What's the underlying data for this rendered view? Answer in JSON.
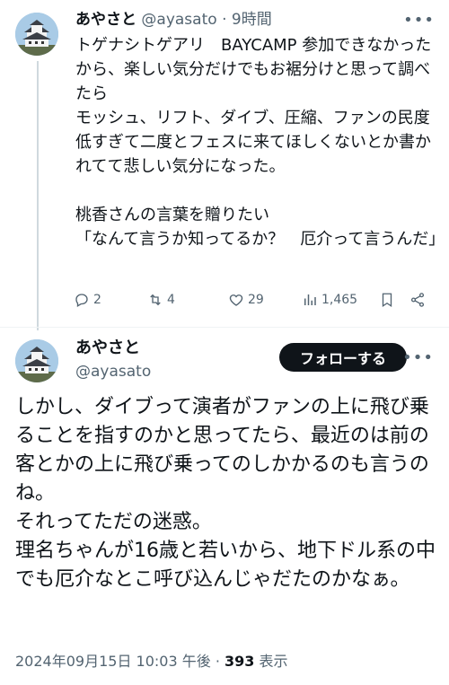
{
  "tweet1": {
    "name": "あやさと",
    "handle": "@ayasato",
    "separator": "·",
    "time": "9時間",
    "body": "トゲナシトゲアリ　BAYCAMP 参加できなかったから、楽しい気分だけでもお裾分けと思って調べたら\nモッシュ、リフト、ダイブ、圧縮、ファンの民度低すぎて二度とフェスに来てほしくないとか書かれてて悲しい気分になった。\n\n桃香さんの言葉を贈りたい\n「なんて言うか知ってるか？　厄介って言うんだ」",
    "replies": "2",
    "retweets": "4",
    "likes": "29",
    "views": "1,465"
  },
  "tweet2": {
    "name": "あやさと",
    "handle": "@ayasato",
    "follow_label": "フォローする",
    "body": "しかし、ダイブって演者がファンの上に飛び乗ることを指すのかと思ってたら、最近のは前の客とかの上に飛び乗ってのしかかるのも言うのね。\nそれってただの迷惑。\n理名ちゃんが16歳と若いから、地下ドル系の中でも厄介なとこ呼び込んじゃだたのかなぁ。",
    "timestamp": "2024年09月15日 10:03 午後",
    "separator": "·",
    "views_count": "393",
    "views_label": "表示"
  },
  "colors": {
    "text": "#0f1419",
    "secondary": "#536471",
    "divider": "#eff3f4",
    "follow_bg": "#0f1419"
  }
}
